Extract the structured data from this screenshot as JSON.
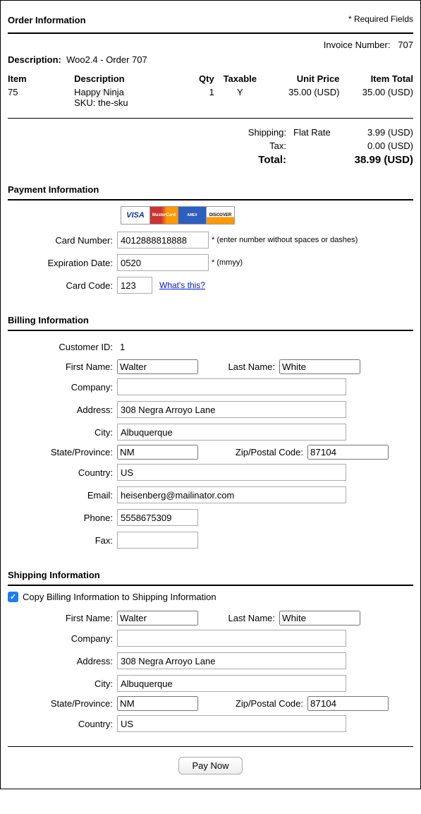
{
  "order": {
    "title": "Order Information",
    "required_fields": "* Required Fields",
    "invoice_label": "Invoice Number:",
    "invoice_number": "707",
    "description_label": "Description:",
    "description": "Woo2.4 - Order 707",
    "headers": {
      "item": "Item",
      "description": "Description",
      "qty": "Qty",
      "taxable": "Taxable",
      "unit_price": "Unit Price",
      "item_total": "Item Total"
    },
    "line": {
      "item": "75",
      "desc": "Happy Ninja",
      "sku": "SKU: the-sku",
      "qty": "1",
      "taxable": "Y",
      "unit_price": "35.00 (USD)",
      "item_total": "35.00 (USD)"
    },
    "shipping": {
      "label": "Shipping:",
      "method": "Flat Rate",
      "amount": "3.99 (USD)"
    },
    "tax": {
      "label": "Tax:",
      "amount": "0.00 (USD)"
    },
    "total": {
      "label": "Total:",
      "amount": "38.99 (USD)"
    }
  },
  "payment": {
    "title": "Payment Information",
    "card_number_label": "Card Number:",
    "card_number": "4012888818888",
    "card_number_hint": "(enter number without spaces or dashes)",
    "exp_label": "Expiration Date:",
    "exp": "0520",
    "exp_hint": "(mmyy)",
    "code_label": "Card Code:",
    "code": "123",
    "whats_this": "What's this?"
  },
  "billing": {
    "title": "Billing Information",
    "customer_id_label": "Customer ID:",
    "customer_id": "1",
    "first_name_label": "First Name:",
    "first_name": "Walter",
    "last_name_label": "Last Name:",
    "last_name": "White",
    "company_label": "Company:",
    "company": "",
    "address_label": "Address:",
    "address": "308 Negra Arroyo Lane",
    "city_label": "City:",
    "city": "Albuquerque",
    "state_label": "State/Province:",
    "state": "NM",
    "zip_label": "Zip/Postal Code:",
    "zip": "87104",
    "country_label": "Country:",
    "country": "US",
    "email_label": "Email:",
    "email": "heisenberg@mailinator.com",
    "phone_label": "Phone:",
    "phone": "5558675309",
    "fax_label": "Fax:",
    "fax": ""
  },
  "shipping": {
    "title": "Shipping Information",
    "copy_label": "Copy Billing Information to Shipping Information",
    "first_name_label": "First Name:",
    "first_name": "Walter",
    "last_name_label": "Last Name:",
    "last_name": "White",
    "company_label": "Company:",
    "company": "",
    "address_label": "Address:",
    "address": "308 Negra Arroyo Lane",
    "city_label": "City:",
    "city": "Albuquerque",
    "state_label": "State/Province:",
    "state": "NM",
    "zip_label": "Zip/Postal Code:",
    "zip": "87104",
    "country_label": "Country:",
    "country": "US"
  },
  "pay_now": "Pay Now",
  "star": "*"
}
